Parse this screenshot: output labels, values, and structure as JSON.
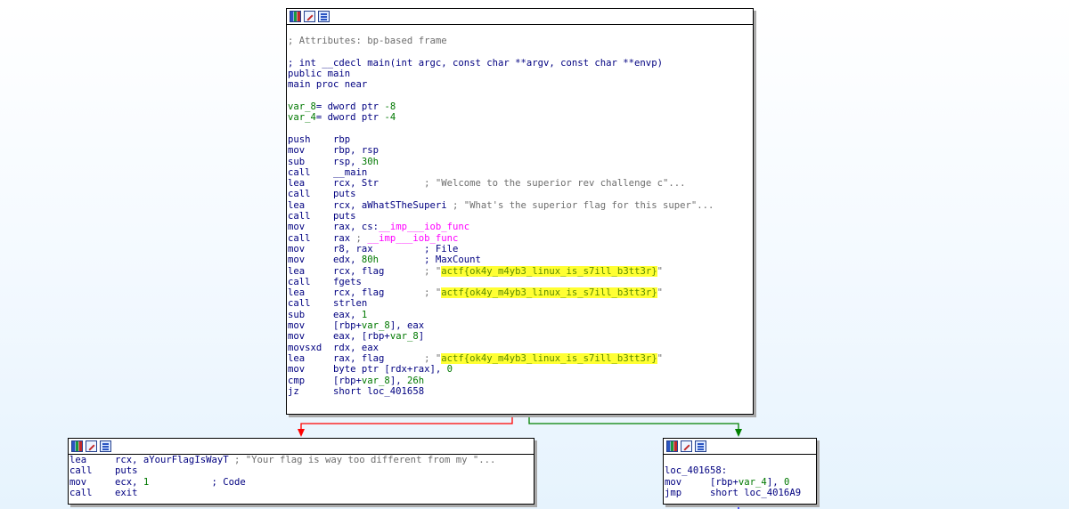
{
  "main_block": {
    "lines": [
      {
        "id": "l0",
        "parts": []
      },
      {
        "id": "l1",
        "parts": [
          {
            "t": "; Attributes: bp-based frame",
            "c": "cmt"
          }
        ]
      },
      {
        "id": "l2",
        "parts": []
      },
      {
        "id": "l3",
        "parts": [
          {
            "t": "; int __cdecl main(int argc, const char **argv, const char **envp)",
            "c": "lbl"
          }
        ]
      },
      {
        "id": "l4",
        "parts": [
          {
            "t": "public main",
            "c": "lbl"
          }
        ]
      },
      {
        "id": "l5",
        "parts": [
          {
            "t": "main proc near",
            "c": "lbl"
          }
        ]
      },
      {
        "id": "l6",
        "parts": []
      },
      {
        "id": "l7",
        "parts": [
          {
            "t": "var_8",
            "c": "lgr"
          },
          {
            "t": "= dword ptr ",
            "c": "lbl"
          },
          {
            "t": "-8",
            "c": "num"
          }
        ]
      },
      {
        "id": "l8",
        "parts": [
          {
            "t": "var_4",
            "c": "lgr"
          },
          {
            "t": "= dword ptr ",
            "c": "lbl"
          },
          {
            "t": "-4",
            "c": "num"
          }
        ]
      },
      {
        "id": "l9",
        "parts": []
      },
      {
        "id": "l10",
        "parts": [
          {
            "t": "push    rbp",
            "c": "lbl"
          }
        ]
      },
      {
        "id": "l11",
        "parts": [
          {
            "t": "mov     rbp, rsp",
            "c": "lbl"
          }
        ]
      },
      {
        "id": "l12",
        "parts": [
          {
            "t": "sub     rsp, ",
            "c": "lbl"
          },
          {
            "t": "30h",
            "c": "num"
          }
        ]
      },
      {
        "id": "l13",
        "parts": [
          {
            "t": "call    __main",
            "c": "lbl"
          }
        ]
      },
      {
        "id": "l14",
        "parts": [
          {
            "t": "lea     rcx, Str        ",
            "c": "lbl"
          },
          {
            "t": "; \"Welcome to the superior rev challenge c\"...",
            "c": "cmt"
          }
        ]
      },
      {
        "id": "l15",
        "parts": [
          {
            "t": "call    puts",
            "c": "lbl"
          }
        ]
      },
      {
        "id": "l16",
        "parts": [
          {
            "t": "lea     rcx, aWhatSTheSuperi ",
            "c": "lbl"
          },
          {
            "t": "; \"What's the superior flag for this super\"...",
            "c": "cmt"
          }
        ]
      },
      {
        "id": "l17",
        "parts": [
          {
            "t": "call    puts",
            "c": "lbl"
          }
        ]
      },
      {
        "id": "l18",
        "parts": [
          {
            "t": "mov     rax, cs:",
            "c": "lbl"
          },
          {
            "t": "__imp___iob_func",
            "c": "imp"
          }
        ]
      },
      {
        "id": "l19",
        "parts": [
          {
            "t": "call    rax ",
            "c": "lbl"
          },
          {
            "t": "; ",
            "c": "cmt"
          },
          {
            "t": "__imp___iob_func",
            "c": "imp"
          }
        ]
      },
      {
        "id": "l20",
        "parts": [
          {
            "t": "mov     r8, rax         ",
            "c": "lbl"
          },
          {
            "t": "; File",
            "c": "lbl"
          }
        ]
      },
      {
        "id": "l21",
        "parts": [
          {
            "t": "mov     edx, ",
            "c": "lbl"
          },
          {
            "t": "80h",
            "c": "num"
          },
          {
            "t": "        ; MaxCount",
            "c": "lbl"
          }
        ]
      },
      {
        "id": "l22",
        "parts": [
          {
            "t": "lea     rcx, flag       ",
            "c": "lbl"
          },
          {
            "t": "; \"",
            "c": "grey"
          },
          {
            "t": "actf{ok4y_m4yb3_linux_is_s7ill_b3tt3r}",
            "c": "hl"
          },
          {
            "t": "\"",
            "c": "grey"
          }
        ]
      },
      {
        "id": "l23",
        "parts": [
          {
            "t": "call    fgets",
            "c": "lbl"
          }
        ]
      },
      {
        "id": "l24",
        "parts": [
          {
            "t": "lea     rcx, flag       ",
            "c": "lbl"
          },
          {
            "t": "; \"",
            "c": "grey"
          },
          {
            "t": "actf{ok4y_m4yb3_linux_is_s7ill_b3tt3r}",
            "c": "hl"
          },
          {
            "t": "\"",
            "c": "grey"
          }
        ]
      },
      {
        "id": "l25",
        "parts": [
          {
            "t": "call    strlen",
            "c": "lbl"
          }
        ]
      },
      {
        "id": "l26",
        "parts": [
          {
            "t": "sub     eax, ",
            "c": "lbl"
          },
          {
            "t": "1",
            "c": "num"
          }
        ]
      },
      {
        "id": "l27",
        "parts": [
          {
            "t": "mov     [rbp+",
            "c": "lbl"
          },
          {
            "t": "var_8",
            "c": "lgr"
          },
          {
            "t": "], eax",
            "c": "lbl"
          }
        ]
      },
      {
        "id": "l28",
        "parts": [
          {
            "t": "mov     eax, [rbp+",
            "c": "lbl"
          },
          {
            "t": "var_8",
            "c": "lgr"
          },
          {
            "t": "]",
            "c": "lbl"
          }
        ]
      },
      {
        "id": "l29",
        "parts": [
          {
            "t": "movsxd  rdx, eax",
            "c": "lbl"
          }
        ]
      },
      {
        "id": "l30",
        "parts": [
          {
            "t": "lea     rax, flag       ",
            "c": "lbl"
          },
          {
            "t": "; \"",
            "c": "grey"
          },
          {
            "t": "actf{ok4y_m4yb3_linux_is_s7ill_b3tt3r}",
            "c": "hl"
          },
          {
            "t": "\"",
            "c": "grey"
          }
        ]
      },
      {
        "id": "l31",
        "parts": [
          {
            "t": "mov     byte ptr [rdx+rax], ",
            "c": "lbl"
          },
          {
            "t": "0",
            "c": "num"
          }
        ]
      },
      {
        "id": "l32",
        "parts": [
          {
            "t": "cmp     [rbp+",
            "c": "lbl"
          },
          {
            "t": "var_8",
            "c": "lgr"
          },
          {
            "t": "], ",
            "c": "lbl"
          },
          {
            "t": "26h",
            "c": "num"
          }
        ]
      },
      {
        "id": "l33",
        "parts": [
          {
            "t": "jz      short loc_401658",
            "c": "lbl"
          }
        ]
      }
    ]
  },
  "fail_block": {
    "lines": [
      {
        "id": "f0",
        "parts": [
          {
            "t": "lea     rcx, aYourFlagIsWayT ",
            "c": "lbl"
          },
          {
            "t": "; \"Your flag is way too different from my \"...",
            "c": "cmt"
          }
        ]
      },
      {
        "id": "f1",
        "parts": [
          {
            "t": "call    puts",
            "c": "lbl"
          }
        ]
      },
      {
        "id": "f2",
        "parts": [
          {
            "t": "mov     ecx, ",
            "c": "lbl"
          },
          {
            "t": "1",
            "c": "num"
          },
          {
            "t": "           ; Code",
            "c": "lbl"
          }
        ]
      },
      {
        "id": "f3",
        "parts": [
          {
            "t": "call    exit",
            "c": "lbl"
          }
        ]
      }
    ]
  },
  "success_block": {
    "lines": [
      {
        "id": "s0",
        "parts": []
      },
      {
        "id": "s1",
        "parts": [
          {
            "t": "loc_401658:",
            "c": "lbl"
          }
        ]
      },
      {
        "id": "s2",
        "parts": [
          {
            "t": "mov     [rbp+",
            "c": "lbl"
          },
          {
            "t": "var_4",
            "c": "lgr"
          },
          {
            "t": "], ",
            "c": "lbl"
          },
          {
            "t": "0",
            "c": "num"
          }
        ]
      },
      {
        "id": "s3",
        "parts": [
          {
            "t": "jmp     short loc_4016A9",
            "c": "lbl"
          }
        ]
      }
    ]
  },
  "colors": {
    "edge_false": "#ff0000",
    "edge_true": "#008000",
    "edge_next": "#0000ff",
    "highlight": "#ffff33"
  }
}
